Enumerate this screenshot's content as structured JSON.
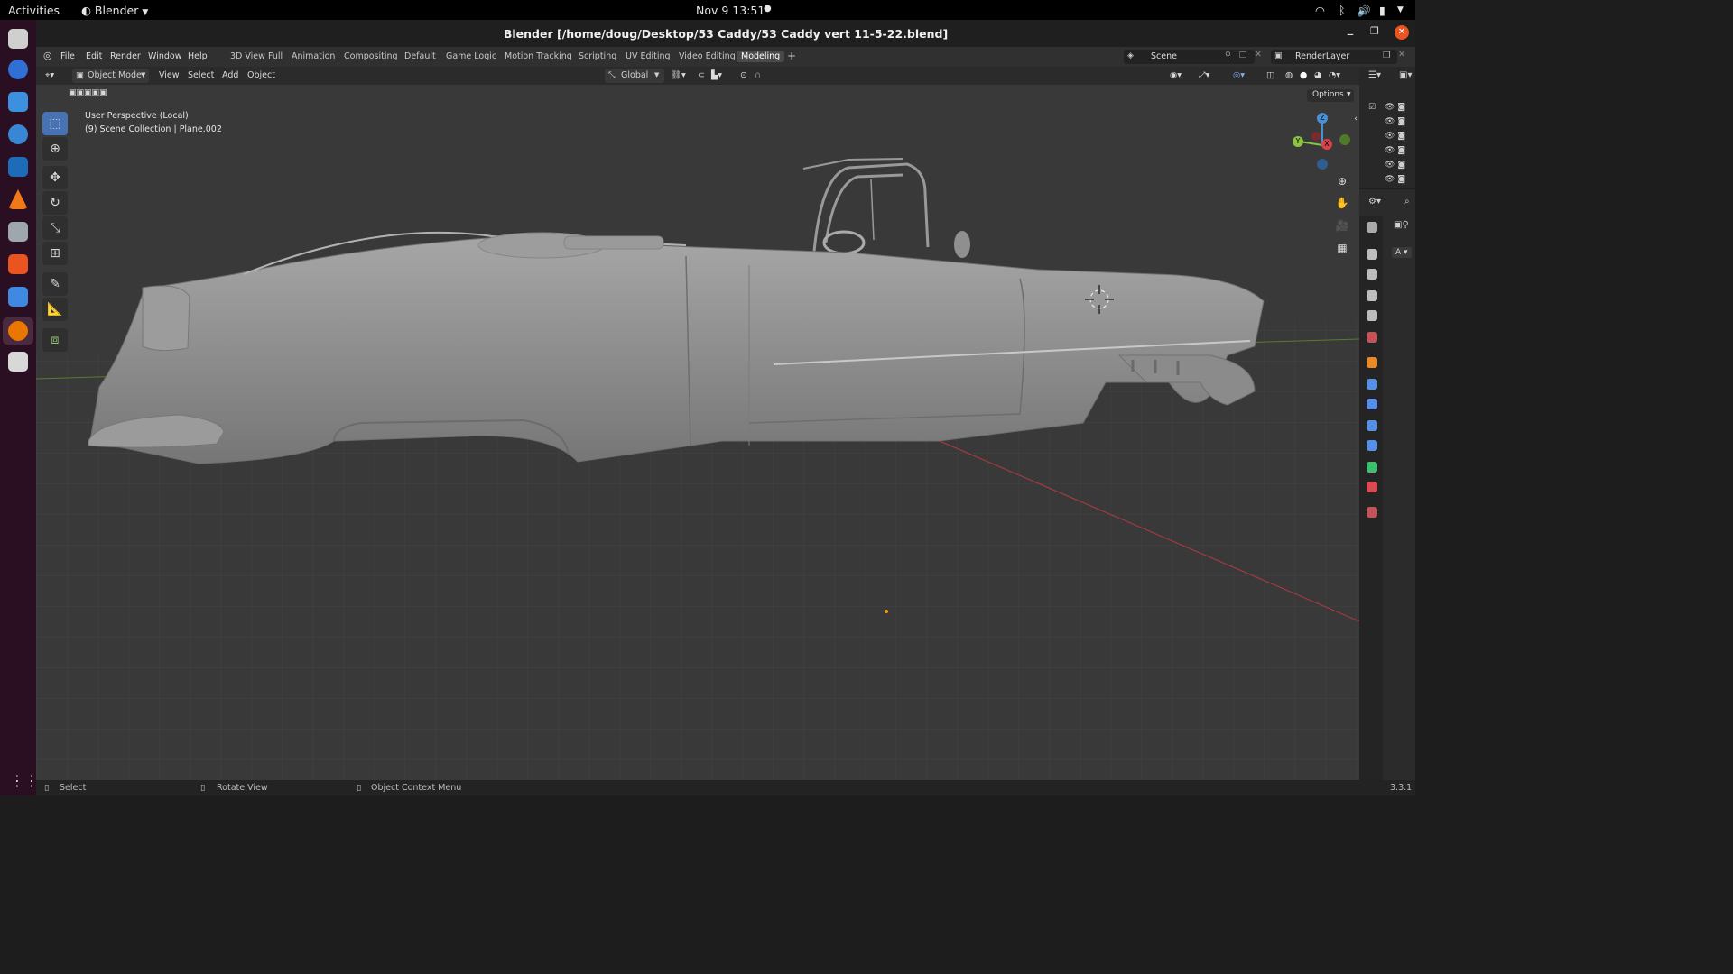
{
  "topbar": {
    "activities": "Activities",
    "app_menu": "Blender",
    "clock": "Nov 9  13:51"
  },
  "window": {
    "title": "Blender [/home/doug/Desktop/53 Caddy/53 Caddy vert 11-5-22.blend]"
  },
  "menu": {
    "items": [
      "File",
      "Edit",
      "Render",
      "Window",
      "Help"
    ]
  },
  "workspaces": {
    "tabs": [
      "3D View Full",
      "Animation",
      "Compositing",
      "Default",
      "Game Logic",
      "Motion Tracking",
      "Scripting",
      "UV Editing",
      "Video Editing",
      "Modeling"
    ],
    "active": "Modeling"
  },
  "scene": {
    "name": "Scene",
    "render_layer": "RenderLayer"
  },
  "header": {
    "mode": "Object Mode",
    "view": "View",
    "select": "Select",
    "add": "Add",
    "object": "Object",
    "transform_orientation": "Global",
    "options": "Options"
  },
  "viewport": {
    "perspective": "User Perspective (Local)",
    "collection": "(9) Scene Collection | Plane.002",
    "gizmo": {
      "z": "Z",
      "y": "Y",
      "x": "X"
    }
  },
  "properties": {
    "collapsed_label": "A"
  },
  "statusbar": {
    "select": "Select",
    "rotate": "Rotate View",
    "context": "Object Context Menu",
    "version": "3.3.1"
  },
  "colors": {
    "accent": "#4772b3",
    "x_axis": "#d9414c",
    "y_axis": "#8ac441",
    "z_axis": "#4a90d9"
  }
}
